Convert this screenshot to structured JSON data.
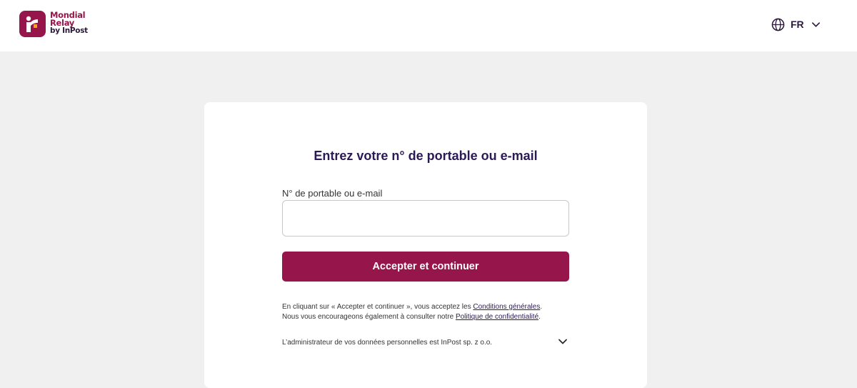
{
  "header": {
    "logo": {
      "line1": "Mondial",
      "line2": "Relay",
      "line3": "by InPost",
      "brand_color": "#96154a"
    },
    "language": {
      "icon": "globe-icon",
      "code": "FR",
      "dropdown_icon": "chevron-down-icon"
    }
  },
  "card": {
    "title": "Entrez votre n° de portable ou e-mail",
    "field_label": "N° de portable ou e-mail",
    "field_value": "",
    "submit_label": "Accepter et continuer",
    "legal": {
      "line1_prefix": "En cliquant sur « Accepter et continuer », vous acceptez les ",
      "terms_link": "Conditions générales",
      "line1_suffix": ".",
      "line2_prefix": "Nous vous encourageons également à consulter notre ",
      "privacy_link": "Politique de confidentialité",
      "line2_suffix": "."
    },
    "admin_text": "L’administrateur de vos données personnelles est InPost sp. z o.o.",
    "admin_toggle_icon": "chevron-down-icon"
  },
  "colors": {
    "accent": "#96154a",
    "title": "#2b1a55",
    "background": "#f0f0f0"
  }
}
